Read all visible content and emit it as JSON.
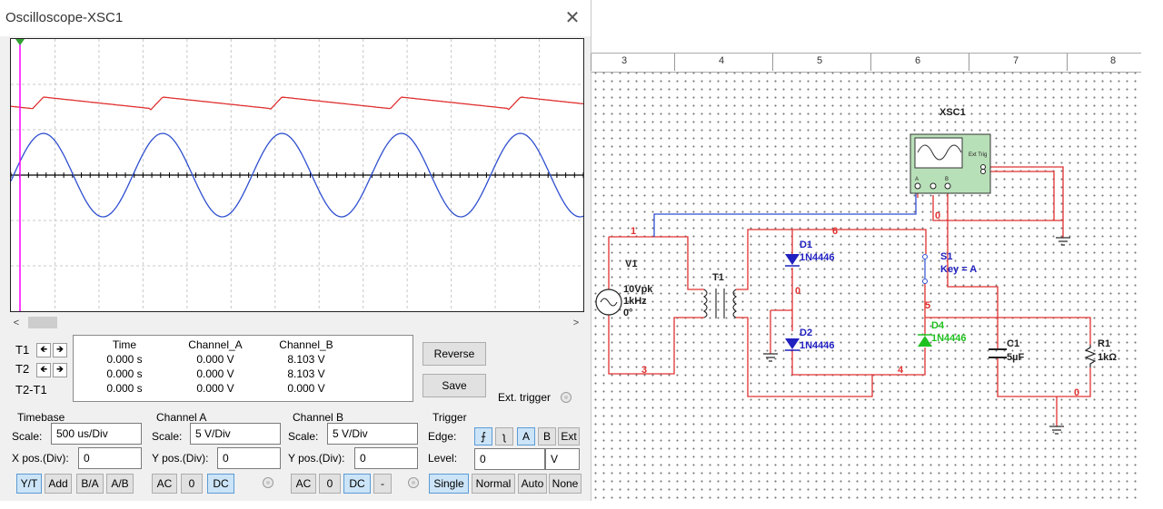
{
  "window": {
    "title": "Oscilloscope-XSC1",
    "close_glyph": "✕"
  },
  "scope": {
    "trace_colors": {
      "channel_a": "#2f4fd0",
      "channel_b": "#e03030",
      "cursor": "#ff00ff"
    }
  },
  "cursors": {
    "t1_label": "T1",
    "t2_label": "T2",
    "diff_label": "T2-T1",
    "left_arrow": "🡸",
    "right_arrow": "🡺"
  },
  "readout": {
    "headers": [
      "Time",
      "Channel_A",
      "Channel_B"
    ],
    "rows": [
      [
        "0.000 s",
        "0.000 V",
        "8.103 V"
      ],
      [
        "0.000 s",
        "0.000 V",
        "8.103 V"
      ],
      [
        "0.000 s",
        "0.000 V",
        "0.000 V"
      ]
    ]
  },
  "buttons": {
    "reverse": "Reverse",
    "save": "Save",
    "ext_trigger": "Ext. trigger"
  },
  "timebase": {
    "title": "Timebase",
    "scale_label": "Scale:",
    "scale_value": "500 us/Div",
    "xpos_label": "X pos.(Div):",
    "xpos_value": "0",
    "modes": [
      "Y/T",
      "Add",
      "B/A",
      "A/B"
    ],
    "selected_mode": "Y/T"
  },
  "channel_a": {
    "title": "Channel A",
    "scale_label": "Scale:",
    "scale_value": "5  V/Div",
    "ypos_label": "Y pos.(Div):",
    "ypos_value": "0",
    "coupling": [
      "AC",
      "0",
      "DC"
    ],
    "selected_coupling": "DC"
  },
  "channel_b": {
    "title": "Channel B",
    "scale_label": "Scale:",
    "scale_value": "5  V/Div",
    "ypos_label": "Y pos.(Div):",
    "ypos_value": "0",
    "coupling": [
      "AC",
      "0",
      "DC",
      "-"
    ],
    "selected_coupling": "DC"
  },
  "trigger": {
    "title": "Trigger",
    "edge_label": "Edge:",
    "edge_rise": "⨍",
    "edge_fall": "ʅ",
    "sources": [
      "A",
      "B",
      "Ext"
    ],
    "selected_source": "A",
    "level_label": "Level:",
    "level_value": "0",
    "level_unit": "V",
    "modes": [
      "Single",
      "Normal",
      "Auto",
      "None"
    ],
    "selected_mode": "Single"
  },
  "ruler": {
    "ticks": [
      "3",
      "4",
      "5",
      "6",
      "7",
      "8"
    ]
  },
  "schematic": {
    "labels": {
      "xsc1": "XSC1",
      "ext_trig": "Ext Trig",
      "pin_a": "A",
      "pin_b": "B",
      "v1": "V1",
      "v1_amp": "10Vpk",
      "v1_freq": "1kHz",
      "v1_phase": "0°",
      "t1": "T1",
      "d1": "D1",
      "d1_part": "1N4446",
      "d2": "D2",
      "d2_part": "1N4446",
      "d4": "D4",
      "d4_part": "1N4446",
      "s1": "S1",
      "s1_key": "Key = A",
      "c1": "C1",
      "c1_val": "5µF",
      "r1": "R1",
      "r1_val": "1kΩ"
    },
    "nets": [
      "1",
      "6",
      "0",
      "3",
      "4",
      "5",
      "0",
      "0"
    ],
    "colors": {
      "wire": "#e03030",
      "blue_wire": "#2f4fd0",
      "diode_blue": "#2020c0",
      "diode_green": "#20c020",
      "instrument": "#b8e0b8"
    }
  }
}
